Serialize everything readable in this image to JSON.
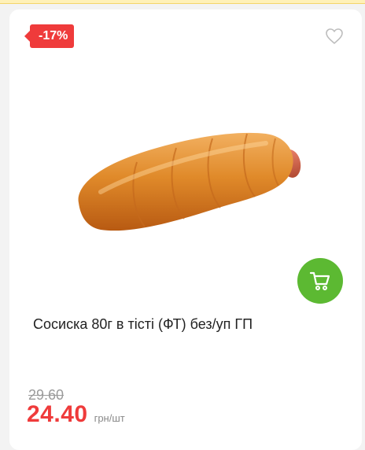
{
  "product": {
    "discount_badge": "-17%",
    "title": "Сосиска 80г в тісті (ФТ) без/уп ГП",
    "old_price": "29.60",
    "new_price": "24.40",
    "unit": "грн/шт",
    "image_description": "sausage-in-dough",
    "favorite_icon": "heart-outline-icon",
    "cart_icon": "shopping-cart-icon"
  },
  "colors": {
    "discount": "#ef3b3b",
    "cart_button": "#5cb932",
    "old_price": "#9b9b9b",
    "title": "#222222"
  }
}
